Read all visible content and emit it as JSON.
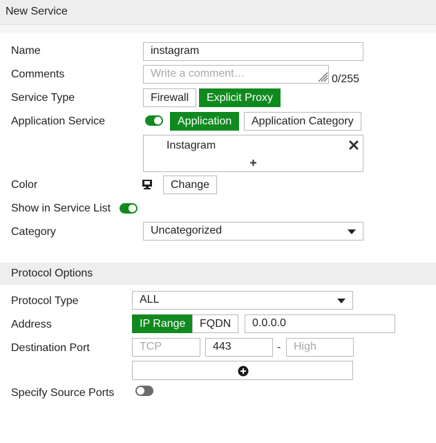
{
  "window": {
    "title": "New Service"
  },
  "form": {
    "name": {
      "label": "Name",
      "value": "instagram"
    },
    "comments": {
      "label": "Comments",
      "placeholder": "Write a comment…",
      "counter": "0/255"
    },
    "service_type": {
      "label": "Service Type",
      "options": [
        "Firewall",
        "Explicit Proxy"
      ],
      "selected": "Explicit Proxy"
    },
    "application_service": {
      "label": "Application Service",
      "toggle": "on",
      "options": [
        "Application",
        "Application Category"
      ],
      "selected": "Application",
      "entries": [
        "Instagram"
      ],
      "remove_icon": "close-icon",
      "add_icon": "plus-icon"
    },
    "color": {
      "label": "Color",
      "icon": "monitor-icon",
      "button": "Change"
    },
    "show_in_service_list": {
      "label": "Show in Service List",
      "toggle": "on"
    },
    "category": {
      "label": "Category",
      "value": "Uncategorized"
    }
  },
  "protocol_options": {
    "title": "Protocol Options",
    "protocol_type": {
      "label": "Protocol Type",
      "value": "ALL"
    },
    "address": {
      "label": "Address",
      "options": [
        "IP Range",
        "FQDN"
      ],
      "selected": "IP Range",
      "value": "0.0.0.0"
    },
    "destination_port": {
      "label": "Destination Port",
      "protocol_placeholder": "TCP",
      "low": "443",
      "separator": "-",
      "high_placeholder": "High",
      "add_icon": "plus-circle-icon"
    },
    "specify_source_ports": {
      "label": "Specify Source Ports",
      "toggle": "off"
    }
  },
  "colors": {
    "accent": "#108a1e",
    "header_bg": "#eeeeee",
    "border": "#b8b8b8"
  }
}
